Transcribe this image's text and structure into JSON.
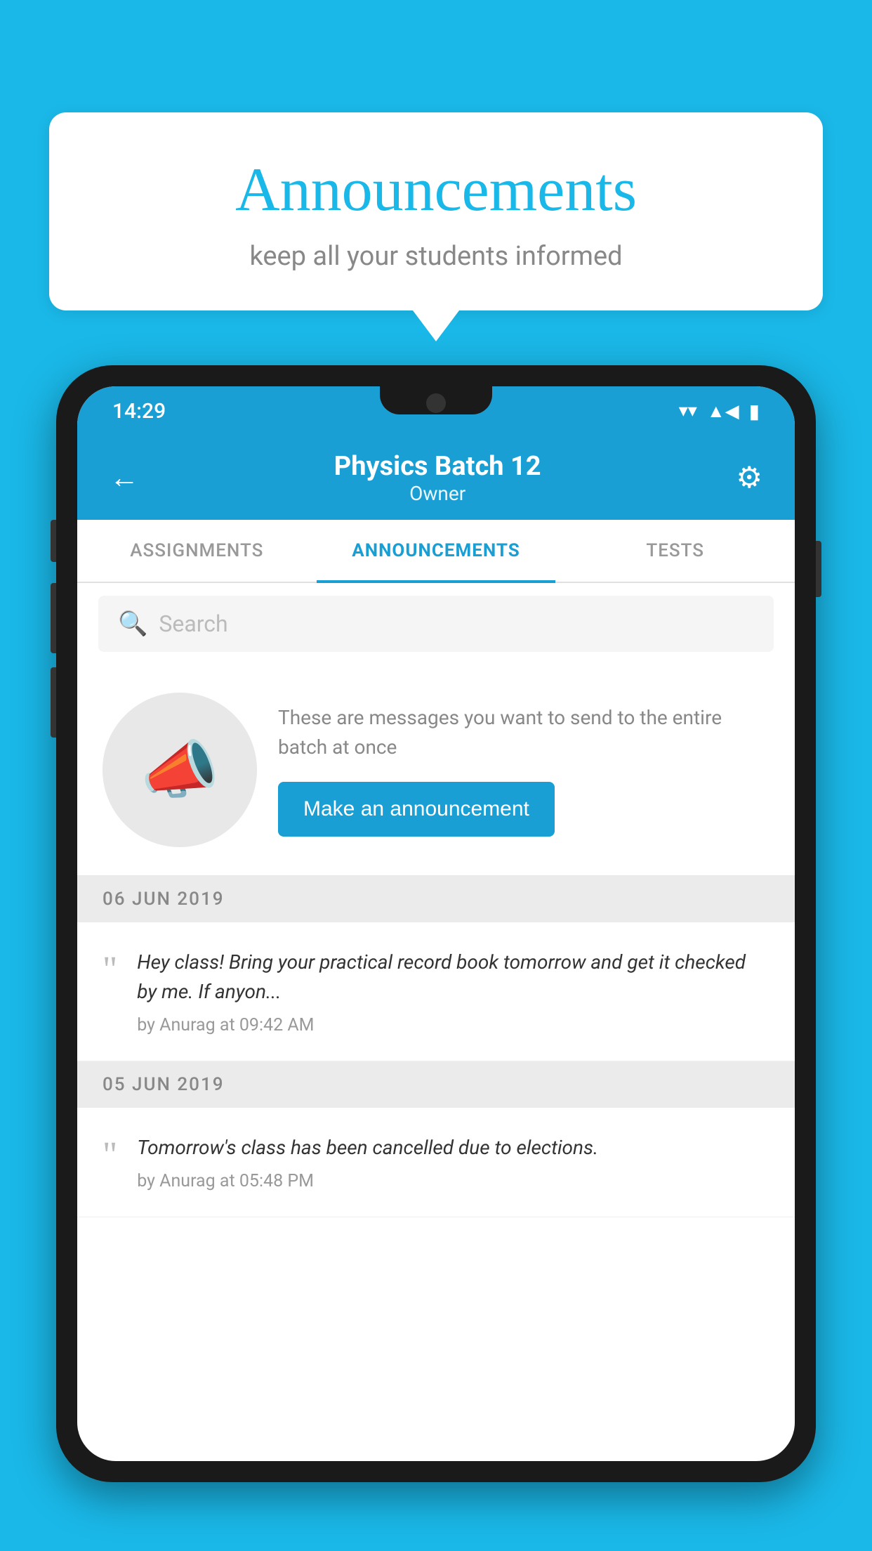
{
  "background_color": "#1ab8e8",
  "speech_bubble": {
    "title": "Announcements",
    "subtitle": "keep all your students informed"
  },
  "status_bar": {
    "time": "14:29",
    "wifi": "▼",
    "signal": "▲",
    "battery": "▮"
  },
  "app_bar": {
    "title": "Physics Batch 12",
    "subtitle": "Owner",
    "back_icon": "←",
    "settings_icon": "⚙"
  },
  "tabs": [
    {
      "label": "ASSIGNMENTS",
      "active": false
    },
    {
      "label": "ANNOUNCEMENTS",
      "active": true
    },
    {
      "label": "TESTS",
      "active": false
    }
  ],
  "search": {
    "placeholder": "Search"
  },
  "promo": {
    "description": "These are messages you want to send to the entire batch at once",
    "button_label": "Make an announcement"
  },
  "date_sections": [
    {
      "date": "06  JUN  2019",
      "announcements": [
        {
          "text": "Hey class! Bring your practical record book tomorrow and get it checked by me. If anyon...",
          "author": "by Anurag at 09:42 AM"
        }
      ]
    },
    {
      "date": "05  JUN  2019",
      "announcements": [
        {
          "text": "Tomorrow's class has been cancelled due to elections.",
          "author": "by Anurag at 05:48 PM"
        }
      ]
    }
  ]
}
